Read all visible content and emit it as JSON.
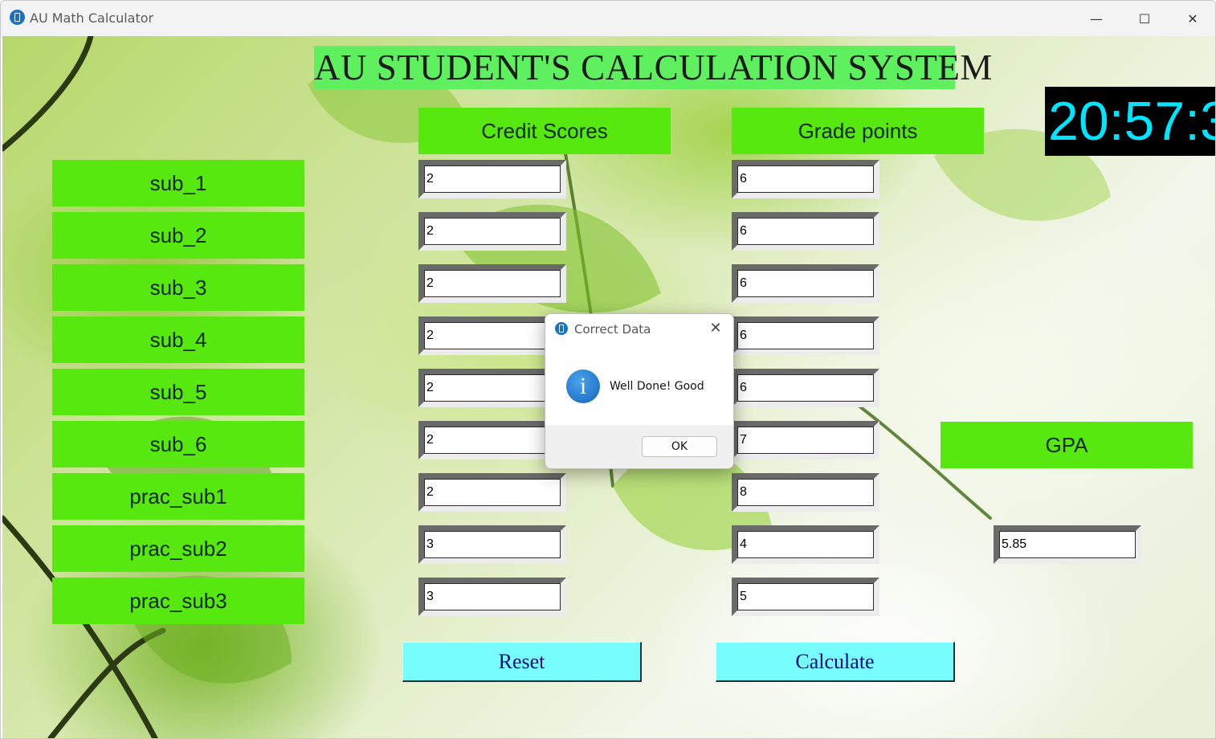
{
  "window": {
    "title": "AU Math Calculator",
    "controls": {
      "minimize": "—",
      "maximize": "☐",
      "close": "✕"
    }
  },
  "header": {
    "title": "AU STUDENT'S CALCULATION SYSTEM"
  },
  "clock": {
    "time": "20:57:3"
  },
  "columns": {
    "credit": "Credit Scores",
    "grade": "Grade points"
  },
  "subjects": [
    {
      "label": "sub_1",
      "credit": "2",
      "grade": "6"
    },
    {
      "label": "sub_2",
      "credit": "2",
      "grade": "6"
    },
    {
      "label": "sub_3",
      "credit": "2",
      "grade": "6"
    },
    {
      "label": "sub_4",
      "credit": "2",
      "grade": "6"
    },
    {
      "label": "sub_5",
      "credit": "2",
      "grade": "6"
    },
    {
      "label": "sub_6",
      "credit": "2",
      "grade": "7"
    },
    {
      "label": "prac_sub1",
      "credit": "2",
      "grade": "8"
    },
    {
      "label": "prac_sub2",
      "credit": "3",
      "grade": "4"
    },
    {
      "label": "prac_sub3",
      "credit": "3",
      "grade": "5"
    }
  ],
  "gpa": {
    "label": "GPA",
    "value": "5.85"
  },
  "buttons": {
    "reset": "Reset",
    "calculate": "Calculate"
  },
  "dialog": {
    "title": "Correct Data",
    "message": "Well Done! Good",
    "ok": "OK",
    "close": "✕",
    "info_glyph": "i"
  },
  "colors": {
    "label_green": "#57e80f",
    "title_green": "#5ef05e",
    "button_cyan": "#77fdfd",
    "clock_text": "#00e5ff",
    "clock_bg": "#000000"
  }
}
